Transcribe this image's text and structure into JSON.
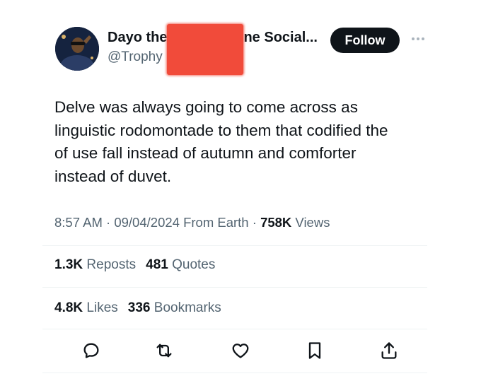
{
  "author": {
    "display_name_start": "Dayo the",
    "display_name_end": "ne Social...",
    "handle": "@Trophy"
  },
  "follow_label": "Follow",
  "tweet": {
    "lines": [
      "Delve was always going to come across as",
      "linguistic rodomontade to them that codified the",
      "of use fall instead of autumn and comforter",
      "instead of duvet."
    ]
  },
  "meta": {
    "time": "8:57 AM",
    "sep1": " · ",
    "date": "09/04/2024",
    "source": " From Earth",
    "sep2": " · ",
    "views_count": "758K",
    "views_label": " Views"
  },
  "stats": {
    "reposts_count": "1.3K",
    "reposts_label": "Reposts",
    "quotes_count": "481",
    "quotes_label": "Quotes",
    "likes_count": "4.8K",
    "likes_label": "Likes",
    "bookmarks_count": "336",
    "bookmarks_label": "Bookmarks"
  },
  "icons": {
    "reply": "speech-bubble-icon",
    "repost": "repost-arrows-icon",
    "like": "heart-icon",
    "bookmark": "bookmark-icon",
    "share": "share-upload-icon",
    "more": "more-dots-icon"
  },
  "colors": {
    "text": "#0f1419",
    "secondary": "#536471",
    "follow_bg": "#0f1419",
    "redaction": "#f14b3a",
    "divider": "#eff3f4"
  }
}
